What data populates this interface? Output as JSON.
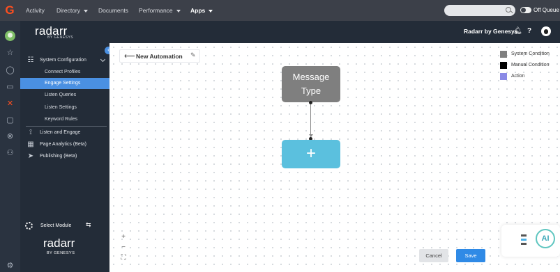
{
  "topnav": {
    "items": [
      {
        "label": "Activity",
        "caret": false,
        "active": false
      },
      {
        "label": "Directory",
        "caret": true,
        "active": false
      },
      {
        "label": "Documents",
        "caret": false,
        "active": false
      },
      {
        "label": "Performance",
        "caret": true,
        "active": false
      },
      {
        "label": "Apps",
        "caret": true,
        "active": true
      }
    ],
    "search_placeholder": "",
    "queue_label": "Off Queue"
  },
  "header": {
    "brand": "radarr",
    "brand_sub": "BY GENESYS",
    "user_label": "Radarr by Genesys"
  },
  "sidebar": {
    "section_title": "System Configuration",
    "sub_items": [
      {
        "label": "Connect Profiles",
        "active": false
      },
      {
        "label": "Engage Settings",
        "active": true
      },
      {
        "label": "Listen Queries",
        "active": false
      },
      {
        "label": "Listen Settings",
        "active": false
      },
      {
        "label": "Keyword Rules",
        "active": false
      }
    ],
    "items": [
      {
        "label": "Listen and Engage",
        "icon": "listen-engage-icon"
      },
      {
        "label": "Page Analytics (Beta)",
        "icon": "analytics-icon"
      },
      {
        "label": "Publishing (Beta)",
        "icon": "send-icon"
      }
    ],
    "select_module": "Select Module",
    "bottom_brand": "radarr",
    "bottom_brand_sub": "BY GENESYS"
  },
  "automation": {
    "title": "New Automation",
    "nodes": {
      "message_type": "Message Type",
      "add": "+"
    }
  },
  "legend": [
    {
      "label": "System Condition",
      "color": "#7f7f7f"
    },
    {
      "label": "Manual Condition",
      "color": "#000000"
    },
    {
      "label": "Action",
      "color": "#8a8ae6"
    }
  ],
  "zoom": [
    "+",
    "−",
    "⛶"
  ],
  "buttons": {
    "cancel": "Cancel",
    "save": "Save"
  },
  "ai_widget": {
    "label": "AI"
  }
}
